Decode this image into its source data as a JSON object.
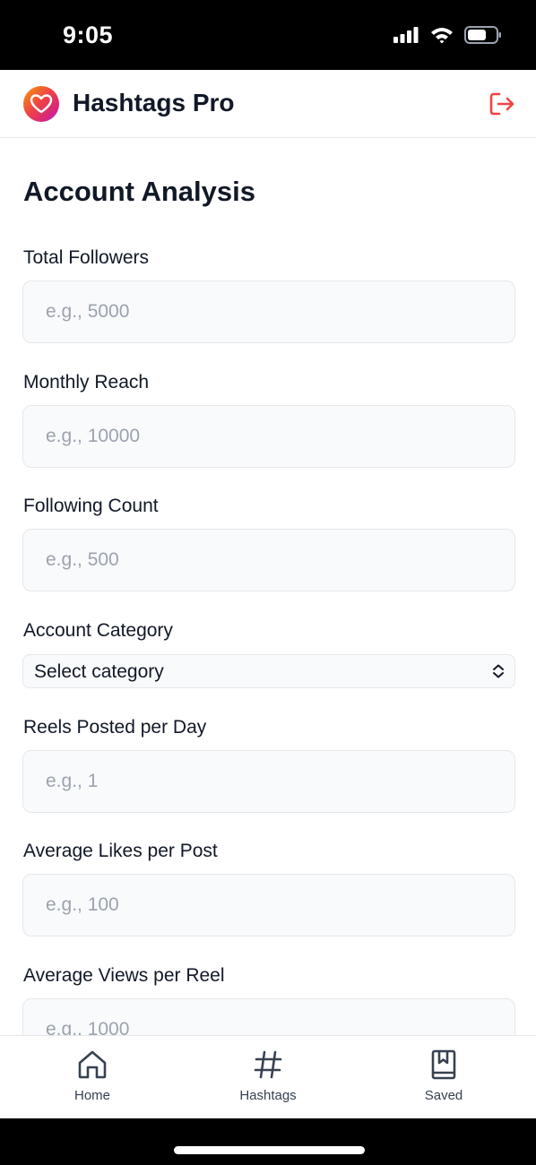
{
  "status_bar": {
    "time": "9:05"
  },
  "header": {
    "title": "Hashtags Pro"
  },
  "form": {
    "title": "Account Analysis",
    "fields": [
      {
        "label": "Total Followers",
        "placeholder": "e.g., 5000"
      },
      {
        "label": "Monthly Reach",
        "placeholder": "e.g., 10000"
      },
      {
        "label": "Following Count",
        "placeholder": "e.g., 500"
      },
      {
        "label": "Reels Posted per Day",
        "placeholder": "e.g., 1"
      },
      {
        "label": "Average Likes per Post",
        "placeholder": "e.g., 100"
      },
      {
        "label": "Average Views per Reel",
        "placeholder": "e.g., 1000"
      }
    ],
    "category": {
      "label": "Account Category",
      "value": "Select category"
    }
  },
  "tabbar": {
    "items": [
      {
        "label": "Home",
        "icon": "home-icon"
      },
      {
        "label": "Hashtags",
        "icon": "hashtag-icon"
      },
      {
        "label": "Saved",
        "icon": "bookmark-book-icon"
      }
    ]
  },
  "colors": {
    "accent": "#ef4444",
    "border": "#e5e7eb",
    "input_bg": "#f9fafb"
  }
}
